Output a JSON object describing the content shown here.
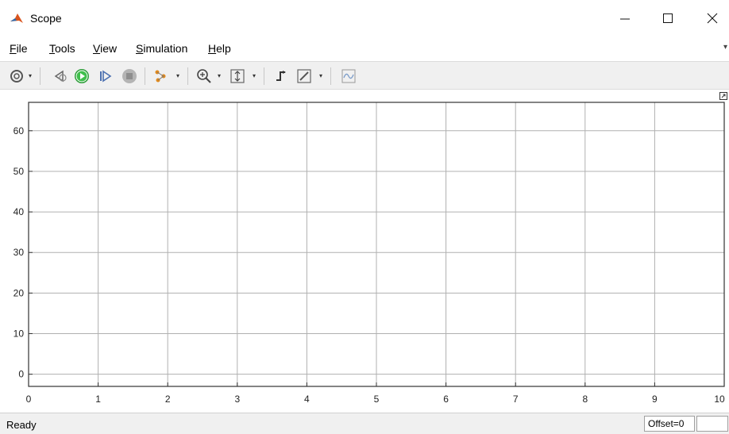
{
  "window": {
    "title": "Scope",
    "minimize_label": "–",
    "maximize_label": "☐",
    "close_label": "✕"
  },
  "menu": {
    "items": [
      {
        "label": "File",
        "accel": "F",
        "rest": "ile"
      },
      {
        "label": "Tools",
        "accel": "T",
        "rest": "ools"
      },
      {
        "label": "View",
        "accel": "V",
        "rest": "iew"
      },
      {
        "label": "Simulation",
        "accel": "S",
        "rest": "imulation"
      },
      {
        "label": "Help",
        "accel": "H",
        "rest": "elp"
      }
    ]
  },
  "toolbar": {
    "icons": [
      "settings-icon",
      "step-back-icon",
      "run-icon",
      "step-forward-icon",
      "stop-icon",
      "highlight-signal-icon",
      "zoom-icon",
      "scale-axes-icon",
      "signal-triggers-icon",
      "style-icon",
      "cursor-measurements-icon"
    ]
  },
  "status": {
    "text": "Ready",
    "offset": "Offset=0"
  },
  "chart_data": {
    "type": "line",
    "title": "",
    "xlabel": "",
    "ylabel": "",
    "xlim": [
      0,
      10
    ],
    "ylim": [
      -3,
      67
    ],
    "x_ticks": [
      "0",
      "1",
      "2",
      "3",
      "4",
      "5",
      "6",
      "7",
      "8",
      "9",
      "10"
    ],
    "y_ticks": [
      "0",
      "10",
      "20",
      "30",
      "40",
      "50",
      "60"
    ],
    "grid": true,
    "series": []
  }
}
